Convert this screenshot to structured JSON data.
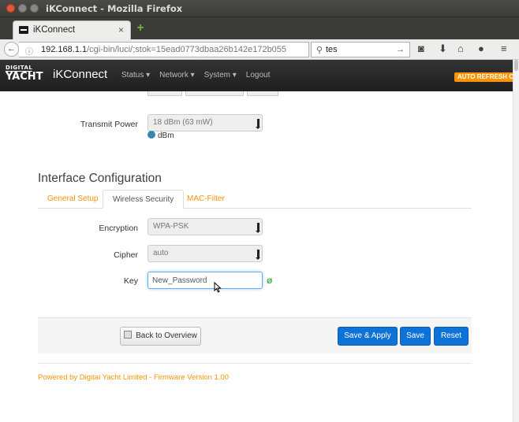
{
  "window": {
    "title": "iKConnect - Mozilla Firefox"
  },
  "browser": {
    "tab_label": "iKConnect",
    "url_host": "192.168.1.1",
    "url_path": "/cgi-bin/luci/;stok=15ead0773dbaa26b142e172b055",
    "search_text": "tes"
  },
  "app": {
    "logo_top": "DIGITAL",
    "logo_bottom": "YACHT",
    "brand": "iKConnect",
    "menu": [
      "Status ▾",
      "Network ▾",
      "System ▾",
      "Logout"
    ],
    "auto_refresh": "AUTO REFRESH ON"
  },
  "transmit": {
    "label": "Transmit Power",
    "value": "18 dBm (63 mW)",
    "hint": "dBm"
  },
  "interface": {
    "title": "Interface Configuration",
    "tabs": [
      "General Setup",
      "Wireless Security",
      "MAC-Filter"
    ],
    "active_tab": "Wireless Security",
    "encryption_label": "Encryption",
    "encryption_value": "WPA-PSK",
    "cipher_label": "Cipher",
    "cipher_value": "auto",
    "key_label": "Key",
    "key_value": "New_Password"
  },
  "actions": {
    "back": "Back to Overview",
    "save_apply": "Save & Apply",
    "save": "Save",
    "reset": "Reset"
  },
  "footer": "Powered by Digital Yacht Limited - Firmware Version 1.00",
  "colors": {
    "accent": "#f89406",
    "primary": "#0e72d6",
    "appbar": "#222222"
  }
}
